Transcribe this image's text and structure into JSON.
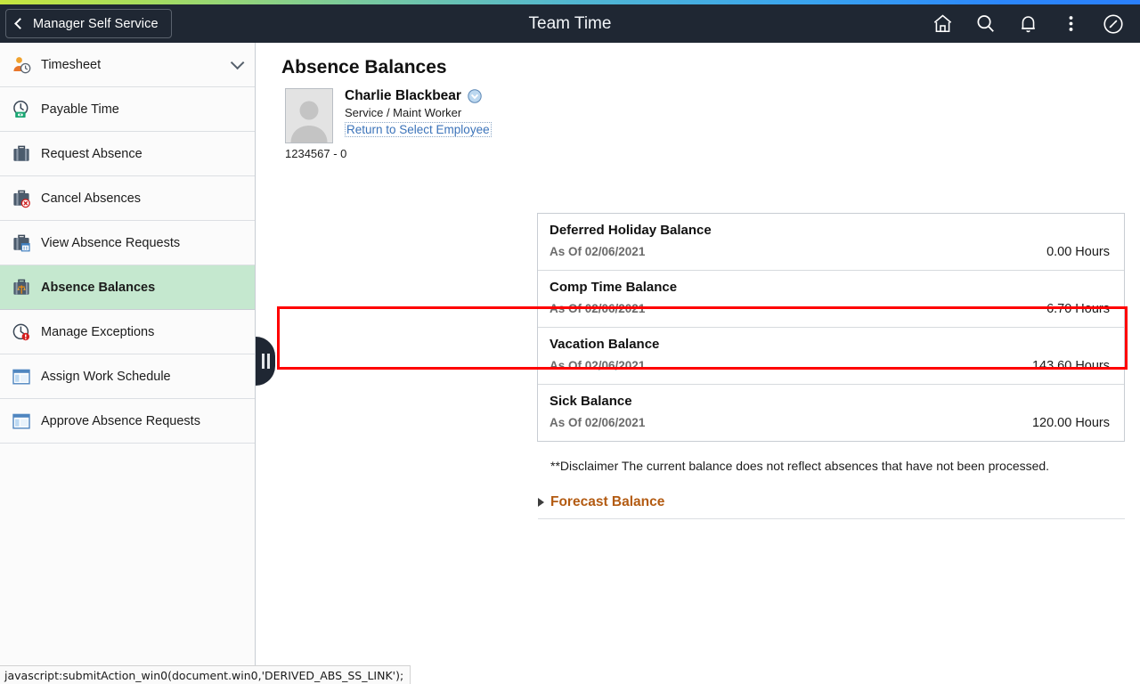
{
  "colors": {
    "header_bg": "#1f2733",
    "accent_gradient_start": "#c6e53f",
    "accent_gradient_end": "#2a7ffb",
    "selected_nav_bg": "#c5e8cf",
    "highlight_border": "#ff0000",
    "link_blue": "#3b73b9",
    "forecast_orange": "#b35b12"
  },
  "header": {
    "back_label": "Manager Self Service",
    "title": "Team Time",
    "icons": [
      {
        "name": "home-icon",
        "glyph": "home"
      },
      {
        "name": "search-icon",
        "glyph": "search"
      },
      {
        "name": "notifications-icon",
        "glyph": "bell"
      },
      {
        "name": "actions-menu-icon",
        "glyph": "kebab"
      },
      {
        "name": "nav-bar-icon",
        "glyph": "compass"
      }
    ]
  },
  "sidebar": {
    "items": [
      {
        "label": "Timesheet",
        "icon": "timesheet-person-clock-icon",
        "selected": false,
        "has_chevron": true
      },
      {
        "label": "Payable Time",
        "icon": "payable-time-clock-cash-icon",
        "selected": false,
        "has_chevron": false
      },
      {
        "label": "Request Absence",
        "icon": "briefcase-icon",
        "selected": false,
        "has_chevron": false
      },
      {
        "label": "Cancel Absences",
        "icon": "briefcase-cancel-icon",
        "selected": false,
        "has_chevron": false
      },
      {
        "label": "View Absence Requests",
        "icon": "briefcase-calendar-icon",
        "selected": false,
        "has_chevron": false
      },
      {
        "label": "Absence Balances",
        "icon": "briefcase-scale-icon",
        "selected": true,
        "has_chevron": false
      },
      {
        "label": "Manage Exceptions",
        "icon": "clock-alert-icon",
        "selected": false,
        "has_chevron": false
      },
      {
        "label": "Assign Work Schedule",
        "icon": "window-panel-icon",
        "selected": false,
        "has_chevron": false
      },
      {
        "label": "Approve Absence Requests",
        "icon": "window-panel-icon",
        "selected": false,
        "has_chevron": false
      }
    ],
    "collapse_handle": "collapse-sidebar-handle"
  },
  "main": {
    "page_title": "Absence Balances",
    "employee": {
      "name": "Charlie Blackbear",
      "job_title": "Service / Maint Worker",
      "return_link": "Return to Select Employee",
      "employee_id": "1234567 - 0"
    },
    "balances": [
      {
        "title": "Deferred Holiday Balance",
        "as_of": "As Of 02/06/2021",
        "value": "0.00 Hours",
        "highlighted": false
      },
      {
        "title": "Comp Time Balance",
        "as_of": "As Of 02/06/2021",
        "value": "6.70 Hours",
        "highlighted": true
      },
      {
        "title": "Vacation Balance",
        "as_of": "As Of 02/06/2021",
        "value": "143.60 Hours",
        "highlighted": false
      },
      {
        "title": "Sick Balance",
        "as_of": "As Of 02/06/2021",
        "value": "120.00 Hours",
        "highlighted": false
      }
    ],
    "disclaimer": "**Disclaimer  The current balance does not reflect absences that have not been processed.",
    "forecast_label": "Forecast Balance"
  },
  "statusbar": {
    "text": "javascript:submitAction_win0(document.win0,'DERIVED_ABS_SS_LINK');"
  }
}
